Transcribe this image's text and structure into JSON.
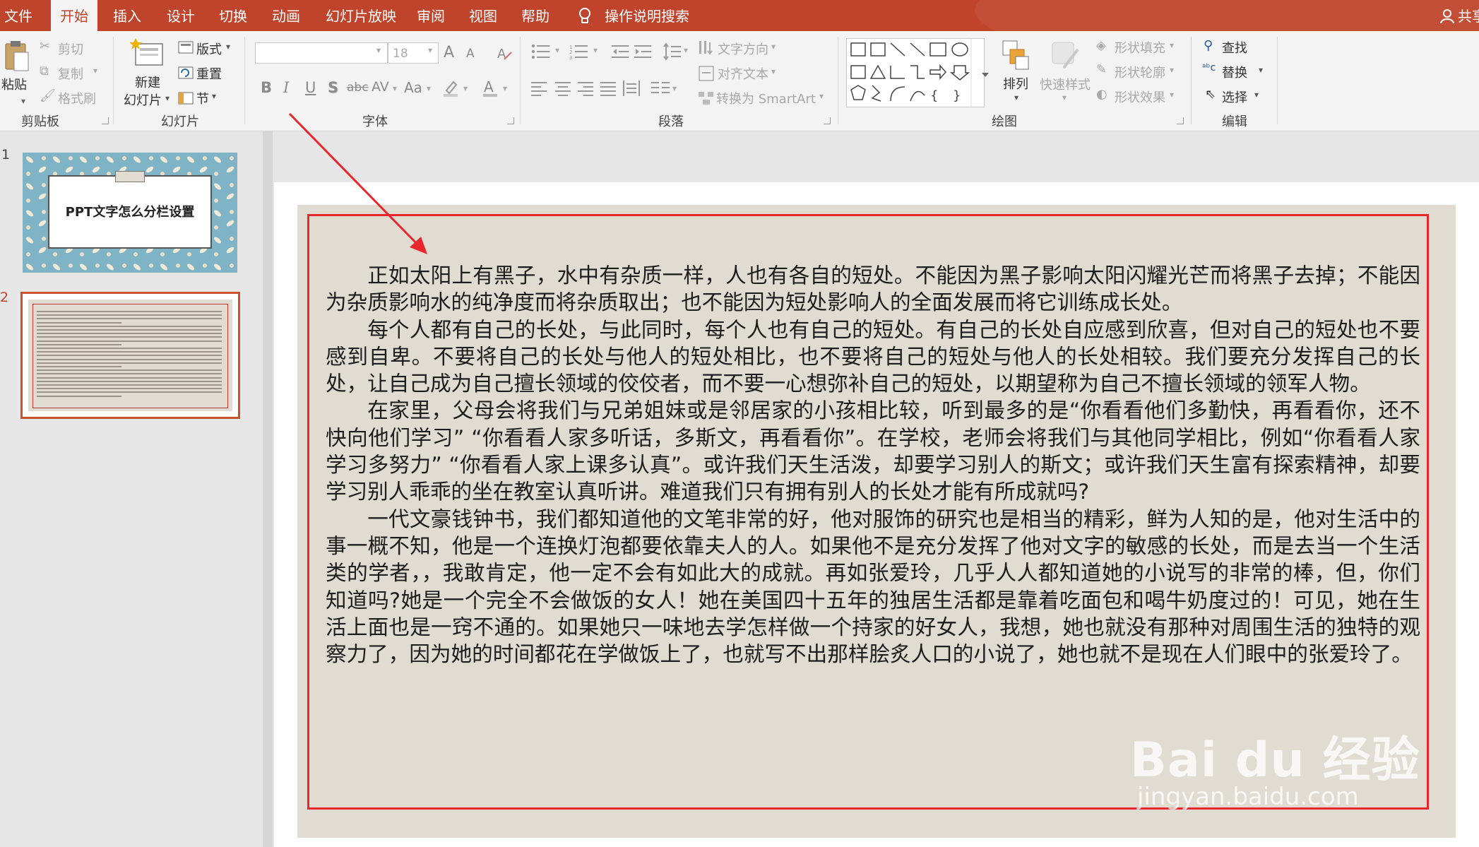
{
  "menu": {
    "tabs": [
      "文件",
      "开始",
      "插入",
      "设计",
      "切换",
      "动画",
      "幻灯片放映",
      "审阅",
      "视图",
      "帮助"
    ],
    "active_tab": "开始",
    "search": "操作说明搜索",
    "share": "共享"
  },
  "ribbon": {
    "clipboard": {
      "paste": "粘贴",
      "cut": "剪切",
      "copy": "复制",
      "format_painter": "格式刷",
      "label": "剪贴板"
    },
    "slides": {
      "new_slide_line1": "新建",
      "new_slide_line2": "幻灯片",
      "layout": "版式",
      "reset": "重置",
      "section": "节",
      "label": "幻灯片"
    },
    "font": {
      "size_value": "18",
      "bold": "B",
      "italic": "I",
      "underline": "U",
      "shadow": "S",
      "strike": "abc",
      "spacing": "AV",
      "case": "Aa",
      "grow": "A",
      "shrink": "A",
      "label": "字体"
    },
    "paragraph": {
      "text_direction": "文字方向",
      "align_text": "对齐文本",
      "smartart": "转换为 SmartArt",
      "label": "段落"
    },
    "drawing": {
      "arrange": "排列",
      "quick_styles": "快速样式",
      "shape_fill": "形状填充",
      "shape_outline": "形状轮廓",
      "shape_effects": "形状效果",
      "label": "绘图"
    },
    "editing": {
      "find": "查找",
      "replace": "替换",
      "select": "选择",
      "label": "编辑"
    }
  },
  "thumbnails": [
    {
      "number": "1",
      "title": "PPT文字怎么分栏设置"
    },
    {
      "number": "2"
    }
  ],
  "slide": {
    "paragraphs": [
      "正如太阳上有黑子，水中有杂质一样，人也有各自的短处。不能因为黑子影响太阳闪耀光芒而将黑子去掉；不能因为杂质影响水的纯净度而将杂质取出；也不能因为短处影响人的全面发展而将它训练成长处。",
      "每个人都有自己的长处，与此同时，每个人也有自己的短处。有自己的长处自应感到欣喜，但对自己的短处也不要感到自卑。不要将自己的长处与他人的短处相比，也不要将自己的短处与他人的长处相较。我们要充分发挥自己的长处，让自己成为自己擅长领域的佼佼者，而不要一心想弥补自己的短处，以期望称为自己不擅长领域的领军人物。",
      "在家里，父母会将我们与兄弟姐妹或是邻居家的小孩相比较，听到最多的是“你看看他们多勤快，再看看你，还不快向他们学习” “你看看人家多听话，多斯文，再看看你”。在学校，老师会将我们与其他同学相比，例如“你看看人家学习多努力” “你看看人家上课多认真”。或许我们天生活泼，却要学习别人的斯文；或许我们天生富有探索精神，却要学习别人乖乖的坐在教室认真听讲。难道我们只有拥有别人的长处才能有所成就吗?",
      "一代文豪钱钟书，我们都知道他的文笔非常的好，他对服饰的研究也是相当的精彩，鲜为人知的是，他对生活中的事一概不知，他是一个连换灯泡都要依靠夫人的人。如果他不是充分发挥了他对文字的敏感的长处，而是去当一个生活类的学者，，我敢肯定，他一定不会有如此大的成就。再如张爱玲，几乎人人都知道她的小说写的非常的棒，但，你们知道吗?她是一个完全不会做饭的女人！她在美国四十五年的独居生活都是靠着吃面包和喝牛奶度过的！可见，她在生活上面也是一窍不通的。如果她只一味地去学怎样做一个持家的好女人，我想，她也就没有那种对周围生活的独特的观察力了，因为她的时间都花在学做饭上了，也就写不出那样脍炙人口的小说了，她也就不是现在人们眼中的张爱玲了。"
    ]
  },
  "watermark": {
    "brand": "Bai du 经验",
    "url": "jingyan.baidu.com"
  },
  "colors": {
    "accent": "#c0432b",
    "annotation_red": "#e8262d",
    "slide_bg": "#e1dcd1"
  }
}
